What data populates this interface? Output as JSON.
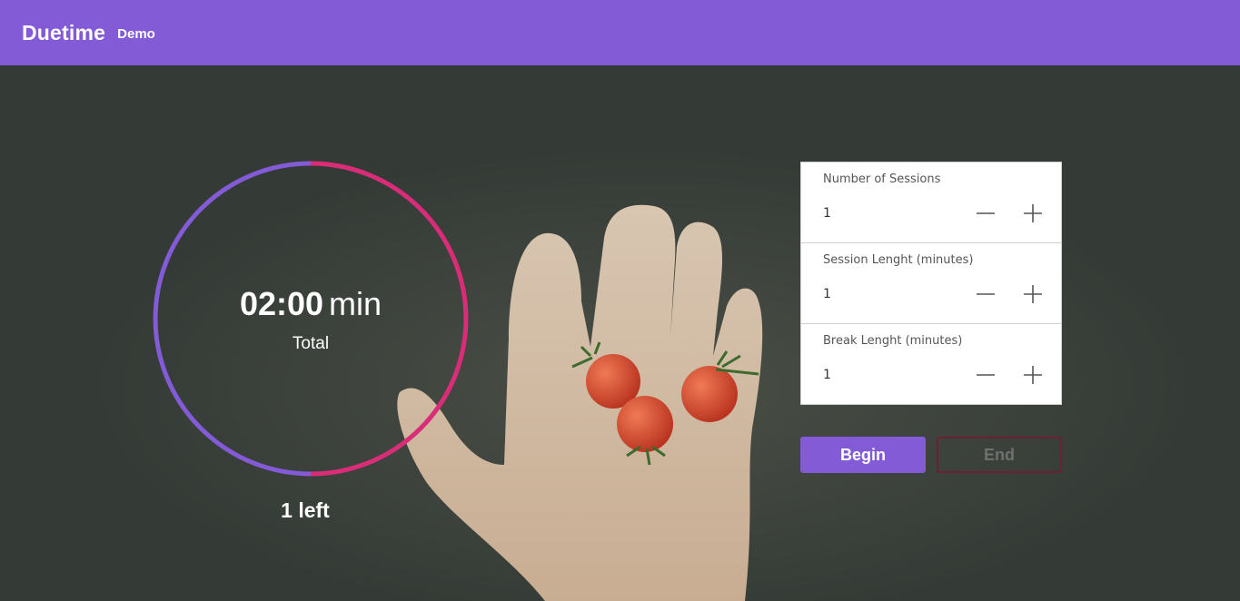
{
  "header": {
    "brand": "Duetime",
    "badge": "Demo",
    "bg_color": "#835bd6"
  },
  "timer": {
    "time": "02:00",
    "unit": "min",
    "label": "Total",
    "remaining": "1 left",
    "ring_colors": {
      "elapsed": "#835bd6",
      "remaining": "#d92c79"
    },
    "progress_fraction": 0.5
  },
  "settings": {
    "fields": [
      {
        "label": "Number of Sessions",
        "value": "1"
      },
      {
        "label": "Session Lenght (minutes)",
        "value": "1"
      },
      {
        "label": "Break Lenght (minutes)",
        "value": "1"
      }
    ],
    "decrement_icon": "minus-icon",
    "increment_icon": "plus-icon"
  },
  "actions": {
    "begin": "Begin",
    "end": "End"
  }
}
